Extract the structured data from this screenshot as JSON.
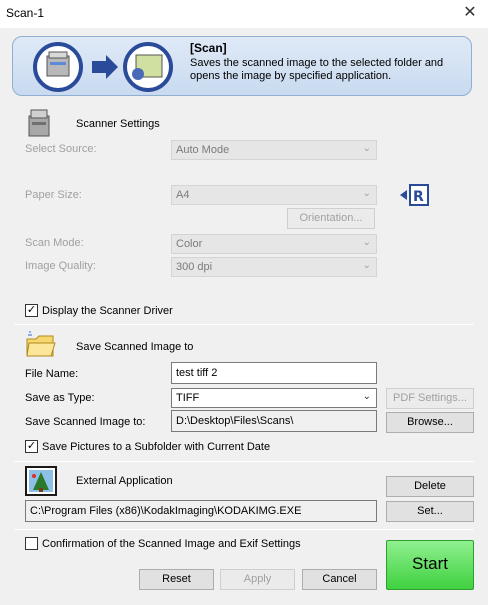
{
  "window": {
    "title": "Scan-1"
  },
  "banner": {
    "title": "[Scan]",
    "description": "Saves the scanned image to the selected folder and opens the image by specified application."
  },
  "scanner": {
    "heading": "Scanner Settings",
    "select_source_label": "Select Source:",
    "select_source_value": "Auto Mode",
    "paper_size_label": "Paper Size:",
    "paper_size_value": "A4",
    "orientation_button": "Orientation...",
    "scan_mode_label": "Scan Mode:",
    "scan_mode_value": "Color",
    "image_quality_label": "Image Quality:",
    "image_quality_value": "300 dpi",
    "display_driver_label": "Display the Scanner Driver",
    "display_driver_checked": true
  },
  "save": {
    "heading": "Save Scanned Image to",
    "file_name_label": "File Name:",
    "file_name_value": "test tiff 2",
    "save_as_type_label": "Save as Type:",
    "save_as_type_value": "TIFF",
    "pdf_settings_button": "PDF Settings...",
    "save_to_label": "Save Scanned Image to:",
    "save_to_value": "D:\\Desktop\\Files\\Scans\\",
    "browse_button": "Browse...",
    "subfolder_label": "Save Pictures to a Subfolder with Current Date",
    "subfolder_checked": true
  },
  "external": {
    "heading": "External Application",
    "delete_button": "Delete",
    "path_value": "C:\\Program Files (x86)\\KodakImaging\\KODAKIMG.EXE",
    "set_button": "Set..."
  },
  "footer": {
    "confirmation_label": "Confirmation of the Scanned Image and Exif Settings",
    "confirmation_checked": false,
    "reset_button": "Reset",
    "apply_button": "Apply",
    "cancel_button": "Cancel",
    "start_button": "Start"
  },
  "icons": {
    "check_glyph": "✓",
    "close_glyph": "✕"
  },
  "colors": {
    "start_green": "#3fd13f",
    "banner_blue": "#c9daf0"
  }
}
